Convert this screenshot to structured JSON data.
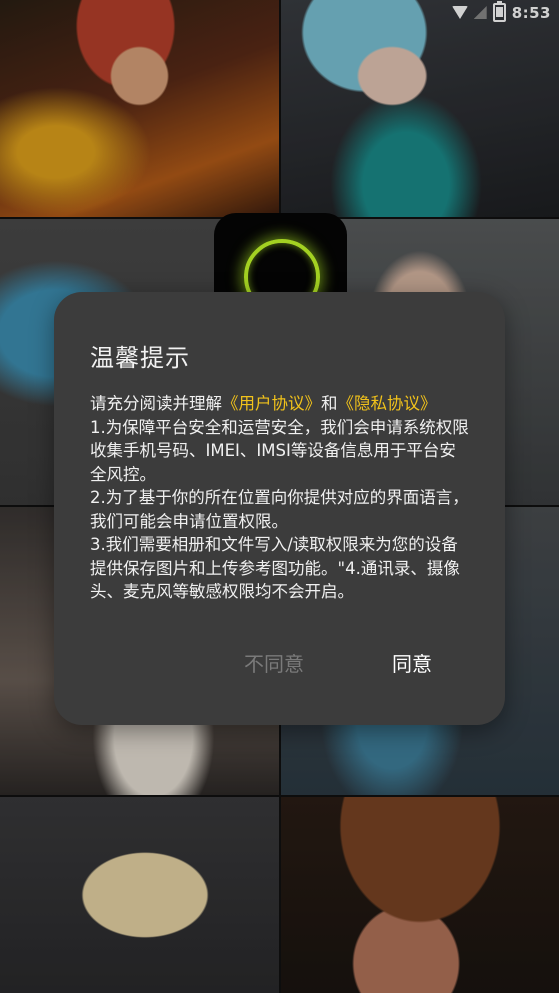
{
  "status_bar": {
    "time": "8:53",
    "icons": [
      "wifi-icon",
      "no-signal-icon",
      "battery-icon"
    ]
  },
  "dialog": {
    "title": "温馨提示",
    "intro_prefix": "请充分阅读并理解",
    "user_agreement_link": "《用户协议》",
    "and_text": "和",
    "privacy_link": "《隐私协议》",
    "item1": "1.为保障平台安全和运营安全，我们会申请系统权限收集手机号码、IMEI、IMSI等设备信息用于平台安全风控。",
    "item2": "2.为了基于你的所在位置向你提供对应的界面语言，我们可能会申请位置权限。",
    "item3": "3.我们需要相册和文件写入/读取权限来为您的设备提供保存图片和上传参考图功能。\"4.通讯录、摄像头、麦克风等敏感权限均不会开启。",
    "disagree_label": "不同意",
    "agree_label": "同意"
  },
  "colors": {
    "link": "#f1c21b",
    "dialog_bg": "#3c3c3c",
    "logo_ring": "#c7ff2a"
  }
}
